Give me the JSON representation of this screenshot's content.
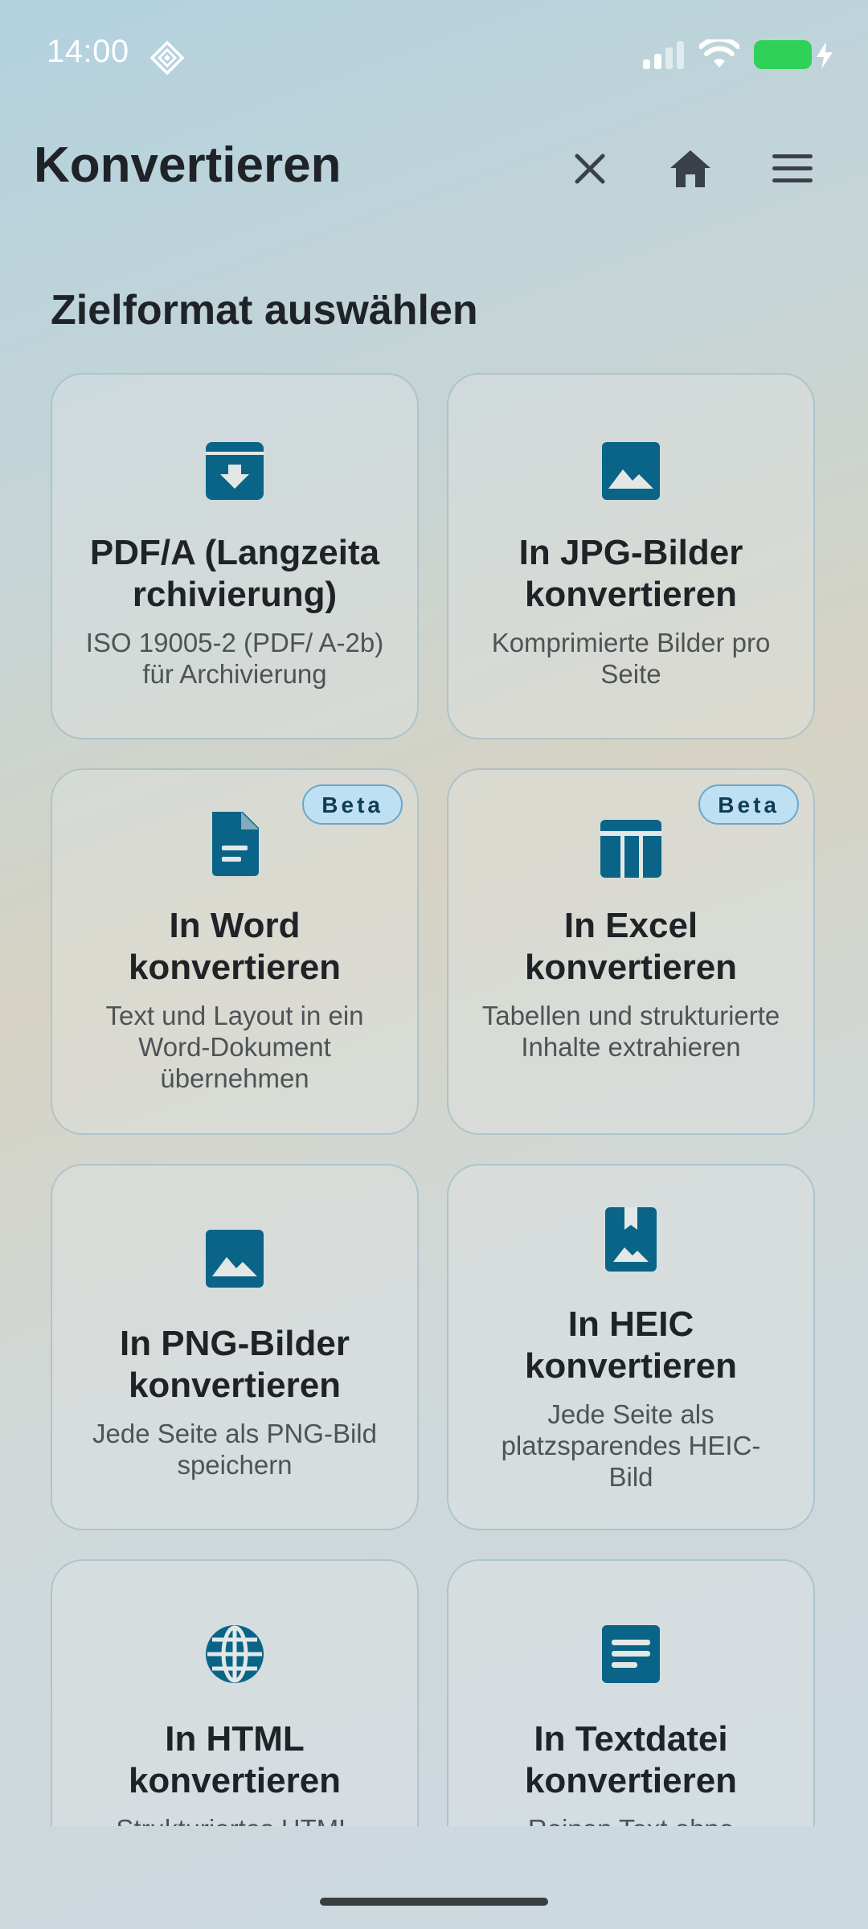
{
  "status": {
    "time": "14:00"
  },
  "header": {
    "title": "Konvertieren"
  },
  "section": {
    "title": "Zielformat auswählen"
  },
  "colors": {
    "accent": "#0a6488",
    "badge_bg": "#bfe0f3",
    "battery": "#2fd158"
  },
  "cards": [
    {
      "icon": "archive-icon",
      "title": "PDF/A (Langzeita rchivierung)",
      "desc": "ISO 19005-2 (PDF/ A-2b) für Archivierung",
      "badge": ""
    },
    {
      "icon": "image-icon",
      "title": "In JPG-Bilder konvertieren",
      "desc": "Komprimierte Bilder pro Seite",
      "badge": ""
    },
    {
      "icon": "document-icon",
      "title": "In Word konvertieren",
      "desc": "Text und Layout in ein Word-Dokument übernehmen",
      "badge": "Beta"
    },
    {
      "icon": "table-icon",
      "title": "In Excel konvertieren",
      "desc": "Tabellen und strukturierte Inhalte extrahieren",
      "badge": "Beta"
    },
    {
      "icon": "image-icon",
      "title": "In PNG-Bilder konvertieren",
      "desc": "Jede Seite als PNG-Bild speichern",
      "badge": ""
    },
    {
      "icon": "photo-portrait-icon",
      "title": "In HEIC konvertieren",
      "desc": "Jede Seite als platzsparendes HEIC-Bild",
      "badge": ""
    },
    {
      "icon": "globe-icon",
      "title": "In HTML konvertieren",
      "desc": "Strukturiertes HTML",
      "badge": ""
    },
    {
      "icon": "text-file-icon",
      "title": "In Textdatei konvertieren",
      "desc": "Reinen Text ohne",
      "badge": ""
    }
  ]
}
